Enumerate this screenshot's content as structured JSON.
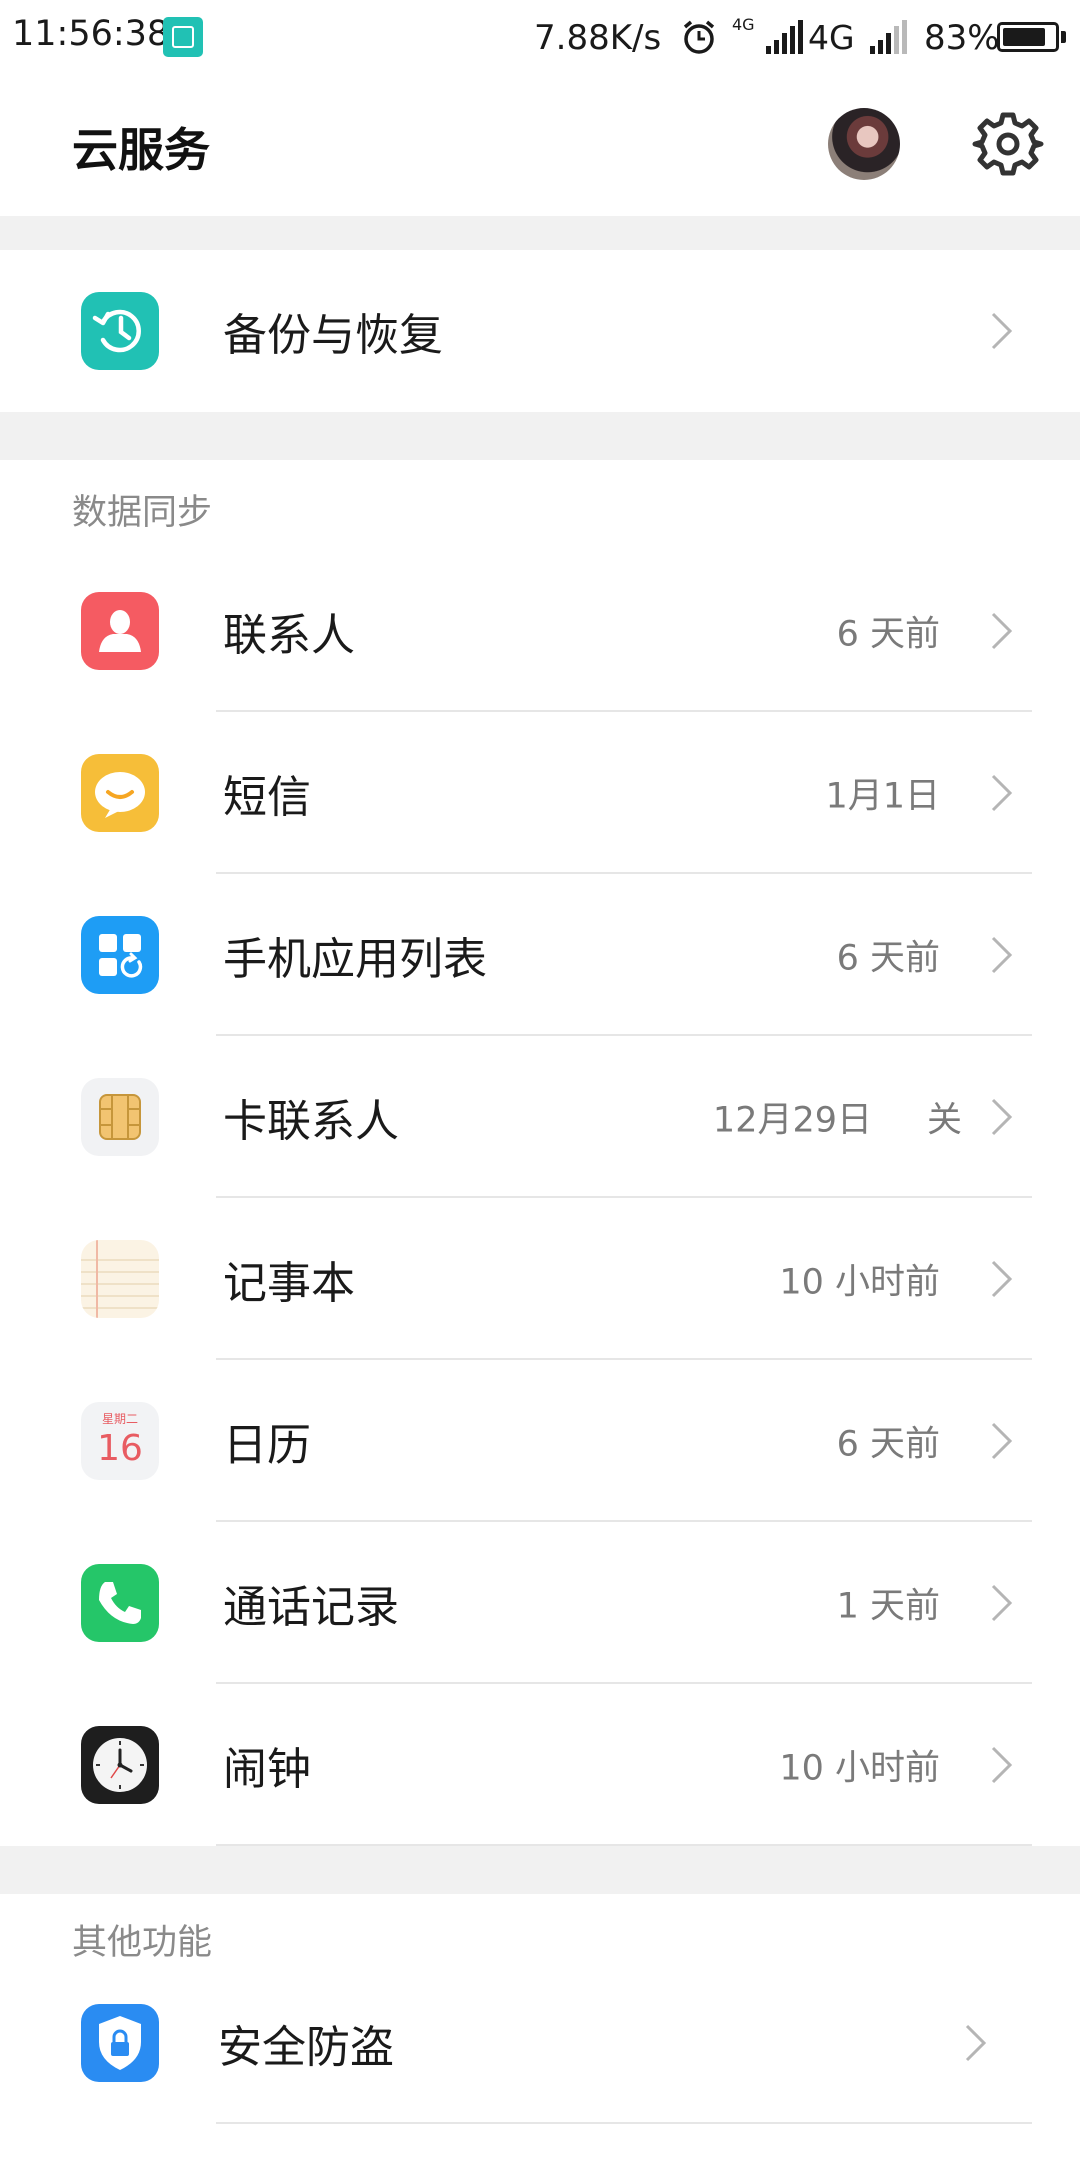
{
  "status_bar": {
    "time": "11:56:38",
    "net_speed": "7.88K/s",
    "network_small": "4G",
    "network": "4G",
    "battery_text": "83%",
    "battery_level": 0.83
  },
  "header": {
    "title": "云服务"
  },
  "backup": {
    "label": "备份与恢复"
  },
  "data_sync": {
    "title": "数据同步",
    "items": [
      {
        "label": "联系人",
        "status": "6 天前"
      },
      {
        "label": "短信",
        "status": "1月1日"
      },
      {
        "label": "手机应用列表",
        "status": "6 天前"
      },
      {
        "label": "卡联系人",
        "status": "12月29日",
        "toggle": "关"
      },
      {
        "label": "记事本",
        "status": "10 小时前"
      },
      {
        "label": "日历",
        "status": "6 天前",
        "icon_weekday": "星期二",
        "icon_day": "16"
      },
      {
        "label": "通话记录",
        "status": "1 天前"
      },
      {
        "label": "闹钟",
        "status": "10 小时前"
      }
    ]
  },
  "other": {
    "title": "其他功能",
    "items": [
      {
        "label": "安全防盗"
      }
    ]
  },
  "colors": {
    "backup_icon": "#21c1b4",
    "contacts_icon": "#f55b62",
    "sms_icon": "#f6be39",
    "apps_icon": "#1e9df5",
    "calls_icon": "#25c669",
    "security_icon": "#2a8cf2"
  }
}
